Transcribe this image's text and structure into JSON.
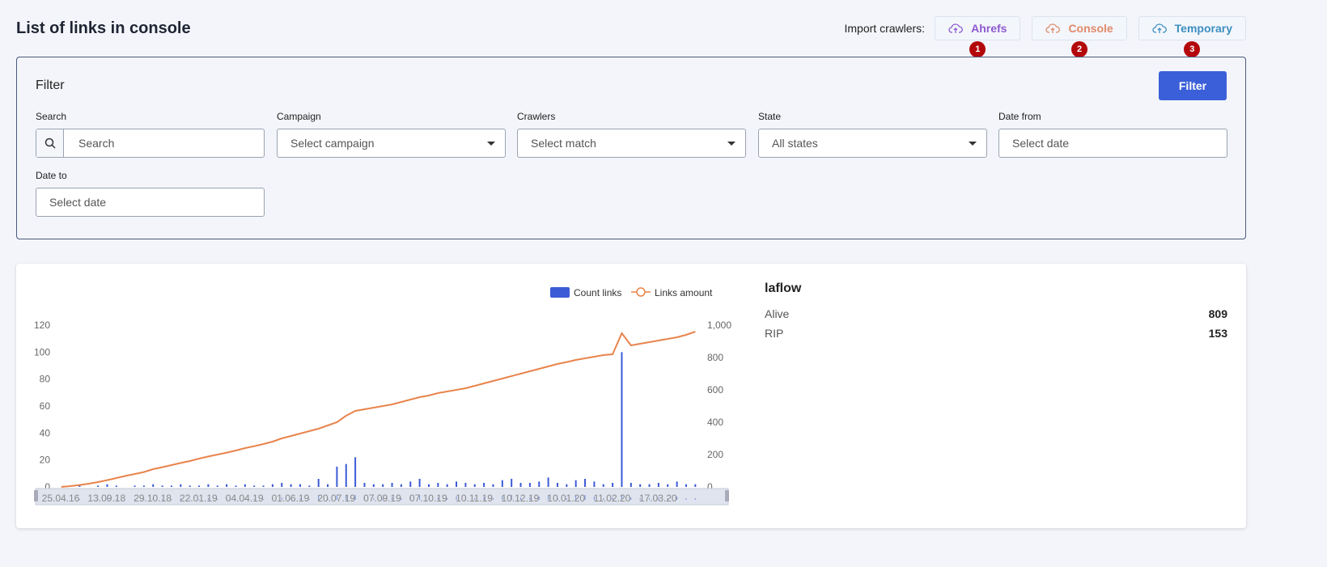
{
  "header": {
    "title": "List of links in console",
    "import_label": "Import crawlers:",
    "buttons": [
      {
        "label": "Ahrefs",
        "badge": "1",
        "color": "#8e5ad0"
      },
      {
        "label": "Console",
        "badge": "2",
        "color": "#e08a6a"
      },
      {
        "label": "Temporary",
        "badge": "3",
        "color": "#3c8fc1"
      }
    ]
  },
  "filter": {
    "title": "Filter",
    "submit": "Filter",
    "search": {
      "label": "Search",
      "placeholder": "Search"
    },
    "campaign": {
      "label": "Campaign",
      "value": "Select campaign"
    },
    "crawlers": {
      "label": "Crawlers",
      "value": "Select match"
    },
    "state": {
      "label": "State",
      "value": "All states"
    },
    "date_from": {
      "label": "Date from",
      "placeholder": "Select date"
    },
    "date_to": {
      "label": "Date to",
      "placeholder": "Select date"
    }
  },
  "stats": {
    "name": "laflow",
    "rows": [
      {
        "label": "Alive",
        "value": "809"
      },
      {
        "label": "RIP",
        "value": "153"
      }
    ]
  },
  "chart_data": {
    "type": "bar+line",
    "legend": [
      "Count links",
      "Links amount"
    ],
    "legend_placement": "top-right",
    "colors": {
      "bar": "#3b5bd6",
      "line": "#e8844c"
    },
    "x_tick_labels": [
      "25.04.16",
      "13.09.18",
      "29.10.18",
      "22.01.19",
      "04.04.19",
      "01.06.19",
      "20.07.19",
      "07.09.19",
      "07.10.19",
      "10.11.19",
      "10.12.19",
      "10.01.20",
      "11.02.20",
      "17.03.20"
    ],
    "y_left": {
      "ticks": [
        0,
        20,
        40,
        60,
        80,
        100,
        120
      ],
      "range": [
        0,
        120
      ]
    },
    "y_right": {
      "ticks": [
        "0",
        "200",
        "400",
        "600",
        "800",
        "1,000"
      ],
      "range": [
        0,
        1000
      ]
    },
    "bars": [
      0,
      0,
      1,
      0,
      1,
      2,
      1,
      0,
      1,
      1,
      2,
      1,
      1,
      2,
      1,
      1,
      2,
      1,
      2,
      1,
      2,
      1,
      1,
      2,
      3,
      2,
      2,
      1,
      6,
      2,
      15,
      17,
      22,
      3,
      2,
      2,
      3,
      2,
      4,
      6,
      2,
      3,
      2,
      4,
      3,
      2,
      3,
      2,
      5,
      6,
      3,
      3,
      4,
      7,
      3,
      2,
      5,
      6,
      4,
      2,
      3,
      100,
      3,
      2,
      2,
      3,
      2,
      4,
      2,
      2
    ],
    "line": [
      0,
      5,
      12,
      20,
      30,
      42,
      55,
      68,
      80,
      92,
      110,
      122,
      135,
      148,
      160,
      175,
      188,
      200,
      212,
      225,
      240,
      252,
      265,
      280,
      300,
      315,
      330,
      345,
      360,
      380,
      400,
      440,
      470,
      480,
      490,
      500,
      510,
      525,
      540,
      555,
      565,
      580,
      590,
      600,
      610,
      625,
      640,
      655,
      670,
      685,
      700,
      715,
      730,
      745,
      760,
      772,
      785,
      795,
      805,
      815,
      820,
      950,
      875,
      885,
      895,
      905,
      915,
      925,
      940,
      960
    ]
  }
}
